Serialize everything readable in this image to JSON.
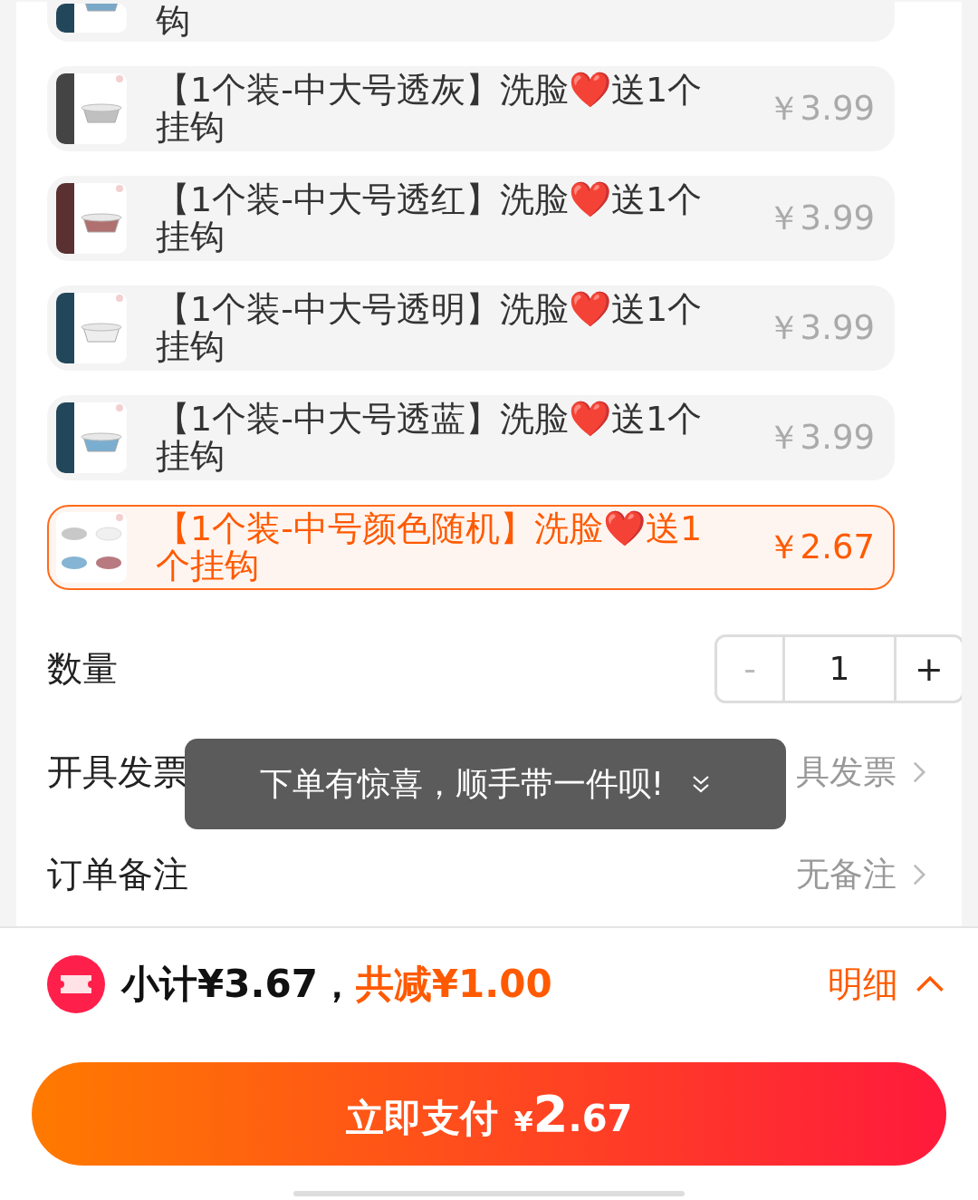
{
  "options": [
    {
      "kind": "partial",
      "name": "钩",
      "selected": false
    },
    {
      "kind": "full",
      "name": "【1个装-中大号透灰】洗脸❤️送1个挂钩",
      "price": "￥3.99",
      "selected": false
    },
    {
      "kind": "full",
      "name": "【1个装-中大号透红】洗脸❤️送1个挂钩",
      "price": "￥3.99",
      "selected": false
    },
    {
      "kind": "full",
      "name": "【1个装-中大号透明】洗脸❤️送1个挂钩",
      "price": "￥3.99",
      "selected": false
    },
    {
      "kind": "full",
      "name": "【1个装-中大号透蓝】洗脸❤️送1个挂钩",
      "price": "￥3.99",
      "selected": false
    },
    {
      "kind": "full",
      "name": "【1个装-中号颜色随机】洗脸❤️送1个挂钩",
      "price": "￥2.67",
      "selected": true
    }
  ],
  "quantity": {
    "label": "数量",
    "minus": "-",
    "value": "1",
    "plus": "+",
    "minus_disabled": true
  },
  "invoice": {
    "label": "开具发票",
    "value": "具发票"
  },
  "note": {
    "label": "订单备注",
    "value": "无备注"
  },
  "toast": {
    "text": "下单有惊喜，顺手带一件呗!"
  },
  "summary": {
    "subtotal": "小计¥3.67，",
    "discount": "共减¥1.00",
    "details": "明细"
  },
  "pay_button": {
    "label": "立即支付",
    "currency": "¥",
    "integer": "2",
    "decimals": ".67"
  }
}
